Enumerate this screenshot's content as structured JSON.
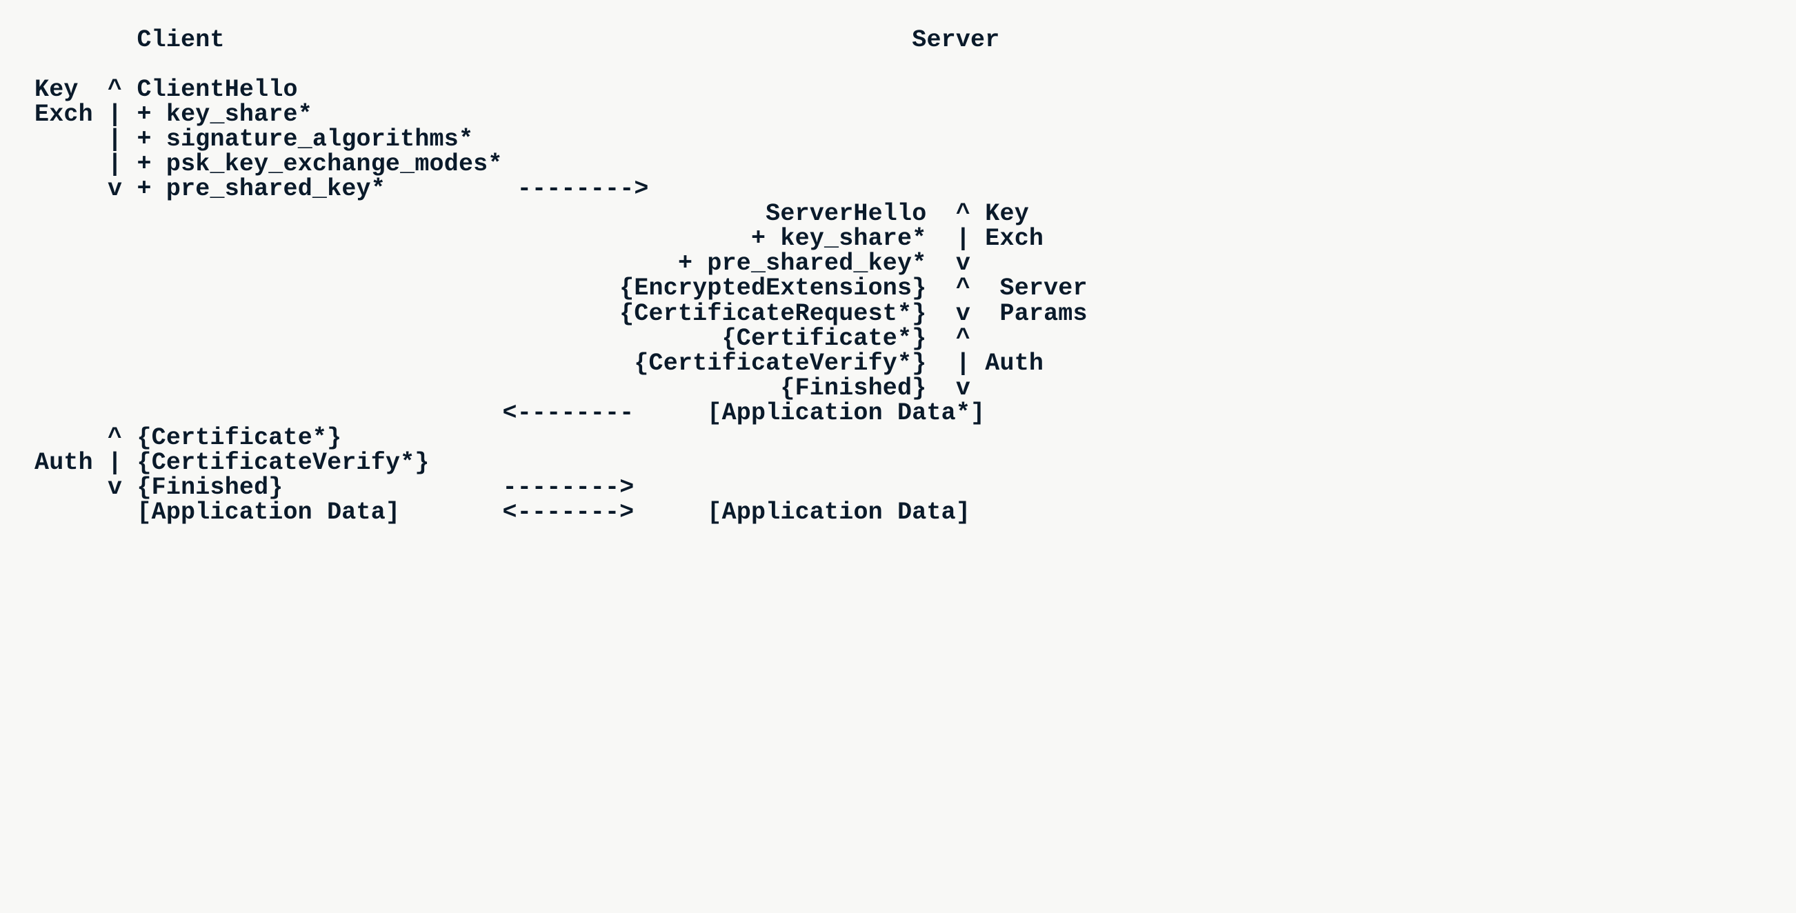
{
  "headers": {
    "client": "Client",
    "server": "Server"
  },
  "phases": {
    "keyExch": "Key",
    "keyExch2": "Exch",
    "serverParams1": "Server",
    "serverParams2": "Params",
    "auth": "Auth"
  },
  "client_messages": {
    "client_hello": "ClientHello",
    "key_share": "+ key_share*",
    "sig_algs": "+ signature_algorithms*",
    "psk_modes": "+ psk_key_exchange_modes*",
    "pre_shared_key": "+ pre_shared_key*",
    "certificate": "{Certificate*}",
    "cert_verify": "{CertificateVerify*}",
    "finished": "{Finished}",
    "app_data": "[Application Data]"
  },
  "server_messages": {
    "server_hello": "ServerHello",
    "key_share": "+ key_share*",
    "pre_shared_key": "+ pre_shared_key*",
    "enc_ext": "{EncryptedExtensions}",
    "cert_req": "{CertificateRequest*}",
    "certificate": "{Certificate*}",
    "cert_verify": "{CertificateVerify*}",
    "finished": "{Finished}",
    "app_data_opt": "[Application Data*]",
    "app_data": "[Application Data]"
  },
  "arrows": {
    "right": "-------->",
    "left": "<--------",
    "both": "<------->"
  },
  "brackets": {
    "top": "^",
    "mid": "|",
    "bot": "v"
  }
}
